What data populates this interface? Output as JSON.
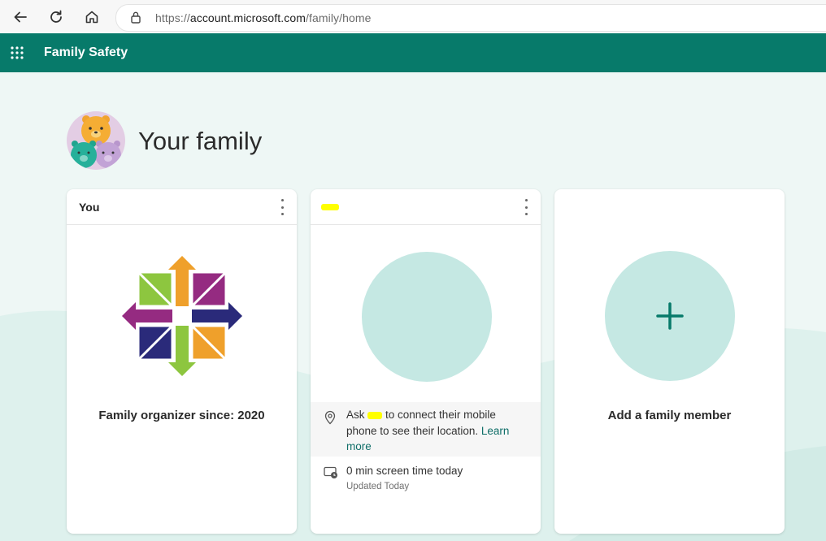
{
  "browser": {
    "url_prefix": "https://",
    "url_domain": "account.microsoft.com",
    "url_path": "/family/home",
    "back_icon": "back-arrow-icon",
    "reload_icon": "reload-icon",
    "home_icon": "home-icon",
    "lock_icon": "lock-icon"
  },
  "header": {
    "app_title": "Family Safety",
    "menu_icon": "waffle-grid-icon",
    "color": "#077a6a"
  },
  "page": {
    "title": "Your family"
  },
  "cards": [
    {
      "name": "You",
      "organizer_text": "Family organizer since: 2020"
    },
    {
      "location_prefix": "Ask ",
      "location_suffix": " to connect their mobile phone to see their location. ",
      "learn_more": "Learn more",
      "screen_time": "0 min screen time today",
      "updated": "Updated Today"
    },
    {
      "add_label": "Add a family member"
    }
  ],
  "colors": {
    "accent": "#077a6a",
    "teal_light": "#c5e8e3",
    "background": "#eef7f5"
  }
}
